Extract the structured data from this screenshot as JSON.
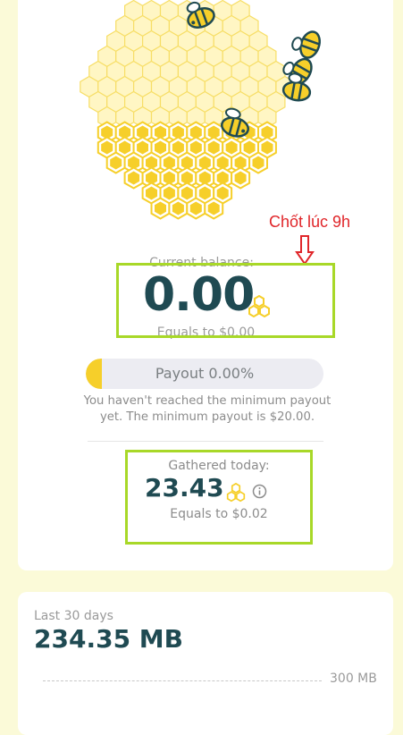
{
  "annotation": {
    "note": "Chốt lúc 9h"
  },
  "balance": {
    "label": "Current balance:",
    "value": "0.00",
    "equals": "Equals to $0.00"
  },
  "payout": {
    "label": "Payout 0.00%",
    "progress_percent": 0,
    "note": "You haven't reached the minimum payout yet. The minimum payout is $20.00."
  },
  "today": {
    "label": "Gathered today:",
    "value": "23.43",
    "equals": "Equals to $0.02"
  },
  "stats": {
    "period_label": "Last 30 days",
    "value": "234.35 MB",
    "axis_label": "300 MB"
  },
  "icons": {
    "coin": "honeycomb-coin-icon",
    "info": "info-icon",
    "arrow": "down-arrow-icon",
    "bee": "bee-icon"
  },
  "colors": {
    "accent_yellow": "#f6cf2a",
    "text_dark": "#1f4a52",
    "highlight_green": "#a8d828",
    "annotation_red": "#e0262a",
    "background": "#fbfad8"
  }
}
